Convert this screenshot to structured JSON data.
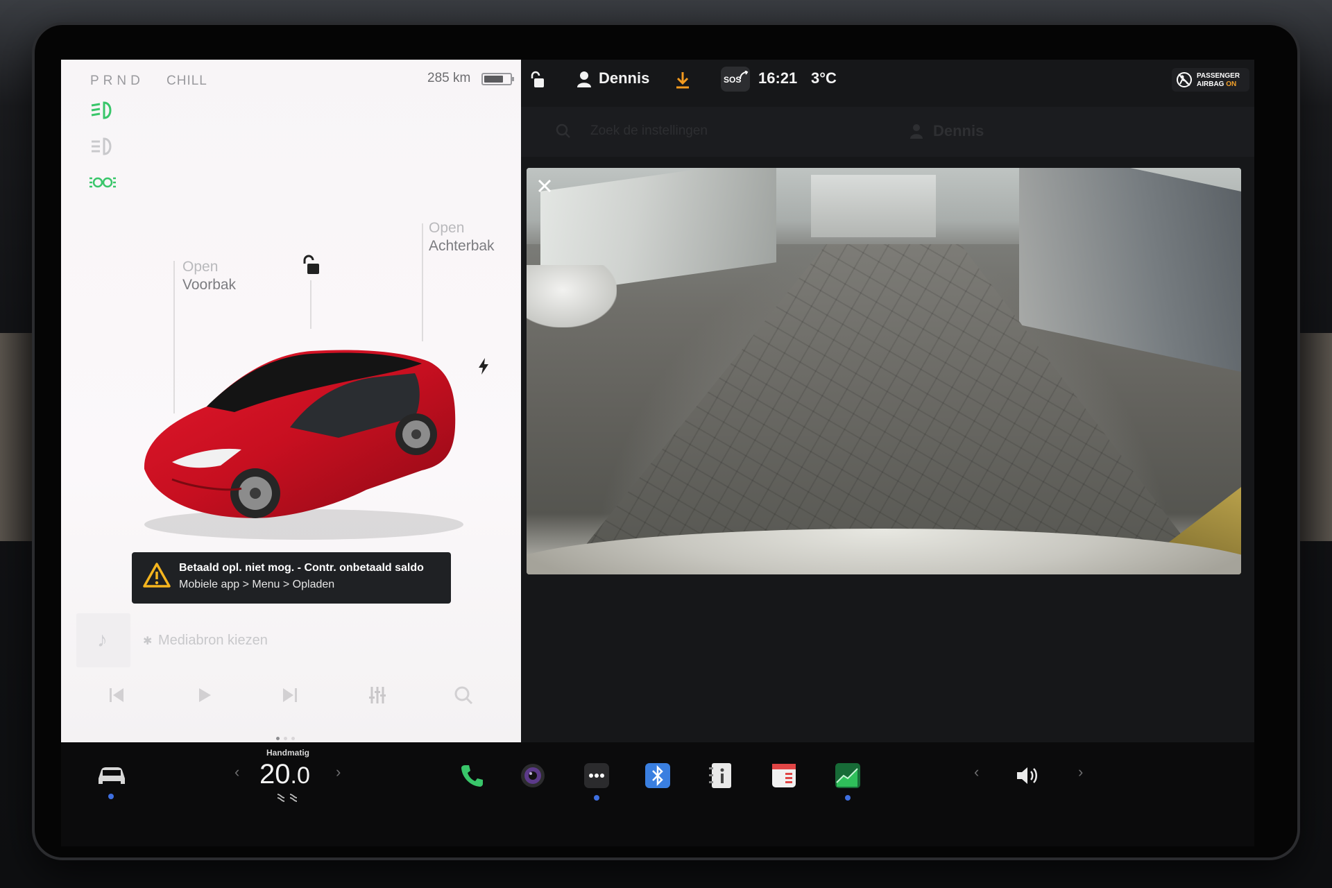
{
  "car_panel": {
    "gear": "PRND",
    "drive_mode": "CHILL",
    "range": "285 km",
    "battery_level": 0.75,
    "frunk": {
      "line1": "Open",
      "line2": "Voorbak"
    },
    "trunk": {
      "line1": "Open",
      "line2": "Achterbak"
    },
    "alert": {
      "title": "Betaald opl. niet mog. - Contr. onbetaald saldo",
      "subtitle": "Mobiele app > Menu > Opladen"
    },
    "media": {
      "source_label": "Mediabron kiezen"
    }
  },
  "status_bar": {
    "profile_name": "Dennis",
    "sos_label": "SOS",
    "time": "16:21",
    "temperature": "3°C",
    "airbag_line1": "PASSENGER",
    "airbag_line2": "AIRBAG",
    "airbag_status": "ON"
  },
  "searchbar": {
    "placeholder": "Zoek de instellingen",
    "ghost_profile": "Dennis"
  },
  "dock": {
    "climate_mode_label": "Handmatig",
    "temperature_int": "20",
    "temperature_dec": ".0",
    "icons": [
      "car-icon",
      "phone-icon",
      "camera-icon",
      "more-icon",
      "bluetooth-icon",
      "manual-icon",
      "calendar-icon",
      "energy-icon",
      "volume-icon"
    ]
  },
  "colors": {
    "accent_green": "#39c66a",
    "alert_bg": "#1f2124",
    "warning_yellow": "#f5b51e",
    "download_orange": "#f39a1f",
    "dock_dot_blue": "#3e6fe0"
  }
}
